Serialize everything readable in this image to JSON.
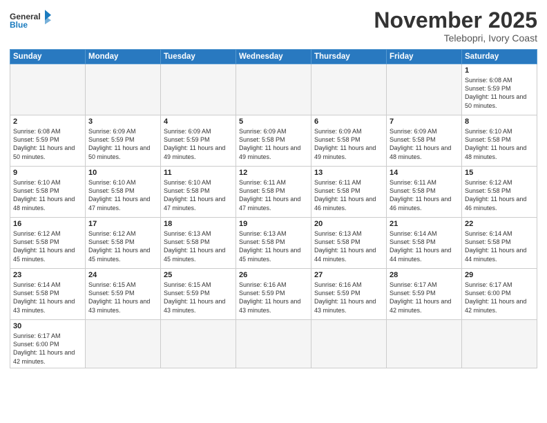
{
  "header": {
    "logo_general": "General",
    "logo_blue": "Blue",
    "month_title": "November 2025",
    "location": "Telebopri, Ivory Coast"
  },
  "weekdays": [
    "Sunday",
    "Monday",
    "Tuesday",
    "Wednesday",
    "Thursday",
    "Friday",
    "Saturday"
  ],
  "weeks": [
    [
      {
        "day": "",
        "info": ""
      },
      {
        "day": "",
        "info": ""
      },
      {
        "day": "",
        "info": ""
      },
      {
        "day": "",
        "info": ""
      },
      {
        "day": "",
        "info": ""
      },
      {
        "day": "",
        "info": ""
      },
      {
        "day": "1",
        "info": "Sunrise: 6:08 AM\nSunset: 5:59 PM\nDaylight: 11 hours\nand 50 minutes."
      }
    ],
    [
      {
        "day": "2",
        "info": "Sunrise: 6:08 AM\nSunset: 5:59 PM\nDaylight: 11 hours\nand 50 minutes."
      },
      {
        "day": "3",
        "info": "Sunrise: 6:09 AM\nSunset: 5:59 PM\nDaylight: 11 hours\nand 50 minutes."
      },
      {
        "day": "4",
        "info": "Sunrise: 6:09 AM\nSunset: 5:59 PM\nDaylight: 11 hours\nand 49 minutes."
      },
      {
        "day": "5",
        "info": "Sunrise: 6:09 AM\nSunset: 5:58 PM\nDaylight: 11 hours\nand 49 minutes."
      },
      {
        "day": "6",
        "info": "Sunrise: 6:09 AM\nSunset: 5:58 PM\nDaylight: 11 hours\nand 49 minutes."
      },
      {
        "day": "7",
        "info": "Sunrise: 6:09 AM\nSunset: 5:58 PM\nDaylight: 11 hours\nand 48 minutes."
      },
      {
        "day": "8",
        "info": "Sunrise: 6:10 AM\nSunset: 5:58 PM\nDaylight: 11 hours\nand 48 minutes."
      }
    ],
    [
      {
        "day": "9",
        "info": "Sunrise: 6:10 AM\nSunset: 5:58 PM\nDaylight: 11 hours\nand 48 minutes."
      },
      {
        "day": "10",
        "info": "Sunrise: 6:10 AM\nSunset: 5:58 PM\nDaylight: 11 hours\nand 47 minutes."
      },
      {
        "day": "11",
        "info": "Sunrise: 6:10 AM\nSunset: 5:58 PM\nDaylight: 11 hours\nand 47 minutes."
      },
      {
        "day": "12",
        "info": "Sunrise: 6:11 AM\nSunset: 5:58 PM\nDaylight: 11 hours\nand 47 minutes."
      },
      {
        "day": "13",
        "info": "Sunrise: 6:11 AM\nSunset: 5:58 PM\nDaylight: 11 hours\nand 46 minutes."
      },
      {
        "day": "14",
        "info": "Sunrise: 6:11 AM\nSunset: 5:58 PM\nDaylight: 11 hours\nand 46 minutes."
      },
      {
        "day": "15",
        "info": "Sunrise: 6:12 AM\nSunset: 5:58 PM\nDaylight: 11 hours\nand 46 minutes."
      }
    ],
    [
      {
        "day": "16",
        "info": "Sunrise: 6:12 AM\nSunset: 5:58 PM\nDaylight: 11 hours\nand 45 minutes."
      },
      {
        "day": "17",
        "info": "Sunrise: 6:12 AM\nSunset: 5:58 PM\nDaylight: 11 hours\nand 45 minutes."
      },
      {
        "day": "18",
        "info": "Sunrise: 6:13 AM\nSunset: 5:58 PM\nDaylight: 11 hours\nand 45 minutes."
      },
      {
        "day": "19",
        "info": "Sunrise: 6:13 AM\nSunset: 5:58 PM\nDaylight: 11 hours\nand 45 minutes."
      },
      {
        "day": "20",
        "info": "Sunrise: 6:13 AM\nSunset: 5:58 PM\nDaylight: 11 hours\nand 44 minutes."
      },
      {
        "day": "21",
        "info": "Sunrise: 6:14 AM\nSunset: 5:58 PM\nDaylight: 11 hours\nand 44 minutes."
      },
      {
        "day": "22",
        "info": "Sunrise: 6:14 AM\nSunset: 5:58 PM\nDaylight: 11 hours\nand 44 minutes."
      }
    ],
    [
      {
        "day": "23",
        "info": "Sunrise: 6:14 AM\nSunset: 5:58 PM\nDaylight: 11 hours\nand 43 minutes."
      },
      {
        "day": "24",
        "info": "Sunrise: 6:15 AM\nSunset: 5:59 PM\nDaylight: 11 hours\nand 43 minutes."
      },
      {
        "day": "25",
        "info": "Sunrise: 6:15 AM\nSunset: 5:59 PM\nDaylight: 11 hours\nand 43 minutes."
      },
      {
        "day": "26",
        "info": "Sunrise: 6:16 AM\nSunset: 5:59 PM\nDaylight: 11 hours\nand 43 minutes."
      },
      {
        "day": "27",
        "info": "Sunrise: 6:16 AM\nSunset: 5:59 PM\nDaylight: 11 hours\nand 43 minutes."
      },
      {
        "day": "28",
        "info": "Sunrise: 6:17 AM\nSunset: 5:59 PM\nDaylight: 11 hours\nand 42 minutes."
      },
      {
        "day": "29",
        "info": "Sunrise: 6:17 AM\nSunset: 6:00 PM\nDaylight: 11 hours\nand 42 minutes."
      }
    ],
    [
      {
        "day": "30",
        "info": "Sunrise: 6:17 AM\nSunset: 6:00 PM\nDaylight: 11 hours\nand 42 minutes."
      },
      {
        "day": "",
        "info": ""
      },
      {
        "day": "",
        "info": ""
      },
      {
        "day": "",
        "info": ""
      },
      {
        "day": "",
        "info": ""
      },
      {
        "day": "",
        "info": ""
      },
      {
        "day": "",
        "info": ""
      }
    ]
  ]
}
